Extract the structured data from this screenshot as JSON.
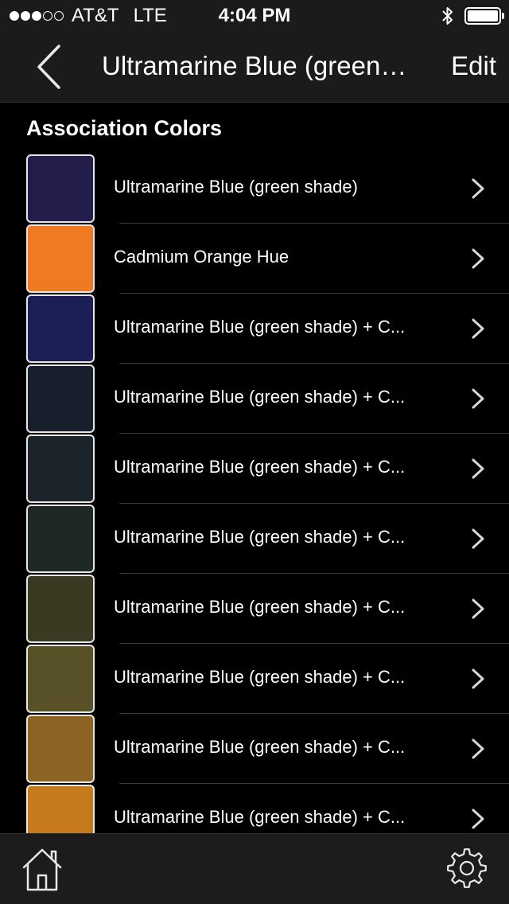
{
  "status_bar": {
    "signal": {
      "full": 3,
      "empty": 2
    },
    "carrier": "AT&T",
    "network": "LTE",
    "time": "4:04 PM",
    "icons": [
      "bluetooth-icon",
      "battery-icon"
    ]
  },
  "nav": {
    "back_icon": "chevron-left-icon",
    "title": "Ultramarine Blue (green…",
    "edit_label": "Edit"
  },
  "section": {
    "title": "Association Colors"
  },
  "colors": [
    {
      "label": "Ultramarine Blue (green shade)",
      "swatch": "#221d4a"
    },
    {
      "label": "Cadmium Orange Hue",
      "swatch": "#f07a22"
    },
    {
      "label": "Ultramarine Blue (green shade) + C...",
      "swatch": "#1c1f56"
    },
    {
      "label": "Ultramarine Blue (green shade) + C...",
      "swatch": "#181e2b"
    },
    {
      "label": "Ultramarine Blue (green shade) + C...",
      "swatch": "#1c242b"
    },
    {
      "label": "Ultramarine Blue (green shade) + C...",
      "swatch": "#1f2826"
    },
    {
      "label": "Ultramarine Blue (green shade) + C...",
      "swatch": "#3a3a22"
    },
    {
      "label": "Ultramarine Blue (green shade) + C...",
      "swatch": "#585128"
    },
    {
      "label": "Ultramarine Blue (green shade) + C...",
      "swatch": "#8c6423"
    },
    {
      "label": "Ultramarine Blue (green shade) + C...",
      "swatch": "#c67a1e"
    }
  ],
  "tab_bar": {
    "home_icon": "home-icon",
    "settings_icon": "gear-icon"
  }
}
